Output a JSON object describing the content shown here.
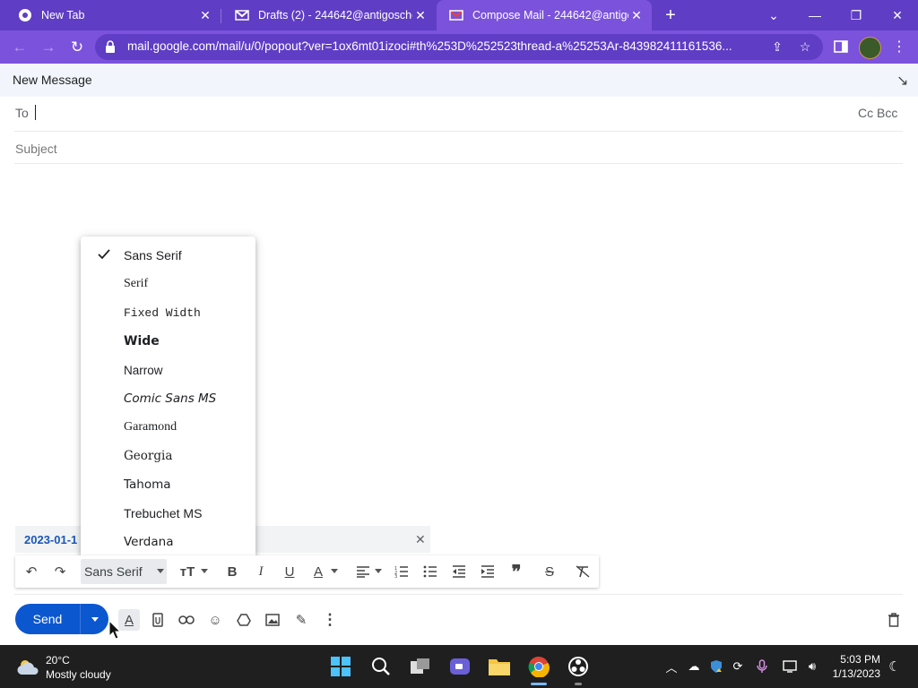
{
  "browser": {
    "tabs": [
      {
        "title": "New Tab",
        "active": false
      },
      {
        "title": "Drafts (2) - 244642@antigoschoo",
        "active": false
      },
      {
        "title": "Compose Mail - 244642@antigo",
        "active": true
      }
    ],
    "url": "mail.google.com/mail/u/0/popout?ver=1ox6mt01izoci#th%253D%252523thread-a%25253Ar-843982411161536..."
  },
  "compose": {
    "title": "New Message",
    "to_label": "To",
    "cc_bcc_label": "Cc Bcc",
    "subject_placeholder": "Subject",
    "attachment_name": "2023-01-1",
    "send_label": "Send"
  },
  "font_menu": {
    "selected": "Sans Serif",
    "items": [
      {
        "label": "Sans Serif",
        "checked": true
      },
      {
        "label": "Serif"
      },
      {
        "label": "Fixed Width"
      },
      {
        "label": "Wide"
      },
      {
        "label": "Narrow"
      },
      {
        "label": "Comic Sans MS"
      },
      {
        "label": "Garamond"
      },
      {
        "label": "Georgia"
      },
      {
        "label": "Tahoma"
      },
      {
        "label": "Trebuchet MS"
      },
      {
        "label": "Verdana"
      }
    ]
  },
  "formatting_bar": {
    "font_value": "Sans Serif"
  },
  "taskbar": {
    "weather_temp": "20°C",
    "weather_desc": "Mostly cloudy",
    "time": "5:03 PM",
    "date": "1/13/2023"
  },
  "colors": {
    "tabstrip": "#5f3dc4",
    "toolbar": "#7b52db",
    "send": "#0b57d0"
  }
}
